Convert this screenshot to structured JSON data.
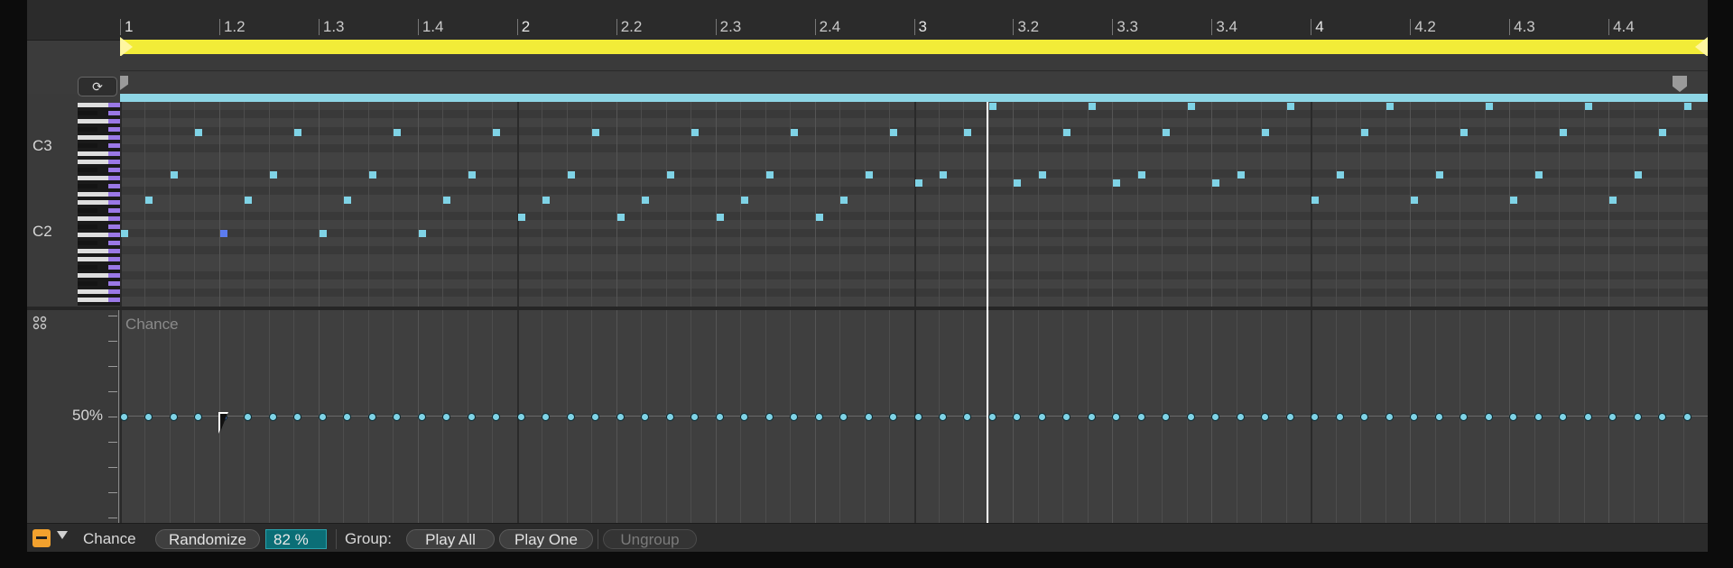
{
  "ruler": {
    "labels": [
      "1",
      "1.2",
      "1.3",
      "1.4",
      "2",
      "2.2",
      "2.3",
      "2.4",
      "3",
      "3.2",
      "3.3",
      "3.4",
      "4",
      "4.2",
      "4.3",
      "4.4"
    ]
  },
  "piano_roll": {
    "octave_labels": [
      "C3",
      "C2"
    ],
    "notes": [
      {
        "beat": 0.0,
        "pitch": 43
      },
      {
        "beat": 0.25,
        "pitch": 47
      },
      {
        "beat": 0.5,
        "pitch": 50
      },
      {
        "beat": 0.75,
        "pitch": 55
      },
      {
        "beat": 1.0,
        "pitch": 43,
        "selected": true
      },
      {
        "beat": 1.25,
        "pitch": 47
      },
      {
        "beat": 1.5,
        "pitch": 50
      },
      {
        "beat": 1.75,
        "pitch": 55
      },
      {
        "beat": 2.0,
        "pitch": 43
      },
      {
        "beat": 2.25,
        "pitch": 47
      },
      {
        "beat": 2.5,
        "pitch": 50
      },
      {
        "beat": 2.75,
        "pitch": 55
      },
      {
        "beat": 3.0,
        "pitch": 43
      },
      {
        "beat": 3.25,
        "pitch": 47
      },
      {
        "beat": 3.5,
        "pitch": 50
      },
      {
        "beat": 3.75,
        "pitch": 55
      },
      {
        "beat": 4.0,
        "pitch": 45
      },
      {
        "beat": 4.25,
        "pitch": 47
      },
      {
        "beat": 4.5,
        "pitch": 50
      },
      {
        "beat": 4.75,
        "pitch": 55
      },
      {
        "beat": 5.0,
        "pitch": 45
      },
      {
        "beat": 5.25,
        "pitch": 47
      },
      {
        "beat": 5.5,
        "pitch": 50
      },
      {
        "beat": 5.75,
        "pitch": 55
      },
      {
        "beat": 6.0,
        "pitch": 45
      },
      {
        "beat": 6.25,
        "pitch": 47
      },
      {
        "beat": 6.5,
        "pitch": 50
      },
      {
        "beat": 6.75,
        "pitch": 55
      },
      {
        "beat": 7.0,
        "pitch": 45
      },
      {
        "beat": 7.25,
        "pitch": 47
      },
      {
        "beat": 7.5,
        "pitch": 50
      },
      {
        "beat": 7.75,
        "pitch": 55
      },
      {
        "beat": 8.0,
        "pitch": 49
      },
      {
        "beat": 8.25,
        "pitch": 50
      },
      {
        "beat": 8.5,
        "pitch": 55
      },
      {
        "beat": 8.75,
        "pitch": 58
      },
      {
        "beat": 9.0,
        "pitch": 49
      },
      {
        "beat": 9.25,
        "pitch": 50
      },
      {
        "beat": 9.5,
        "pitch": 55
      },
      {
        "beat": 9.75,
        "pitch": 58
      },
      {
        "beat": 10.0,
        "pitch": 49
      },
      {
        "beat": 10.25,
        "pitch": 50
      },
      {
        "beat": 10.5,
        "pitch": 55
      },
      {
        "beat": 10.75,
        "pitch": 58
      },
      {
        "beat": 11.0,
        "pitch": 49
      },
      {
        "beat": 11.25,
        "pitch": 50
      },
      {
        "beat": 11.5,
        "pitch": 55
      },
      {
        "beat": 11.75,
        "pitch": 58
      },
      {
        "beat": 12.0,
        "pitch": 47
      },
      {
        "beat": 12.25,
        "pitch": 50
      },
      {
        "beat": 12.5,
        "pitch": 55
      },
      {
        "beat": 12.75,
        "pitch": 58
      },
      {
        "beat": 13.0,
        "pitch": 47
      },
      {
        "beat": 13.25,
        "pitch": 50
      },
      {
        "beat": 13.5,
        "pitch": 55
      },
      {
        "beat": 13.75,
        "pitch": 58
      },
      {
        "beat": 14.0,
        "pitch": 47
      },
      {
        "beat": 14.25,
        "pitch": 50
      },
      {
        "beat": 14.5,
        "pitch": 55
      },
      {
        "beat": 14.75,
        "pitch": 58
      },
      {
        "beat": 15.0,
        "pitch": 47
      },
      {
        "beat": 15.25,
        "pitch": 50
      },
      {
        "beat": 15.5,
        "pitch": 55
      },
      {
        "beat": 15.75,
        "pitch": 58
      }
    ]
  },
  "velocity_lane": {
    "title": "Chance",
    "value_label": "50%",
    "chance_value": 0.5,
    "dot_count": 64,
    "selected_index": 4
  },
  "bottom_bar": {
    "chance_label": "Chance",
    "randomize_label": "Randomize",
    "percent_value": "82 %",
    "group_label": "Group:",
    "play_all_label": "Play All",
    "play_one_label": "Play One",
    "ungroup_label": "Ungroup"
  },
  "colors": {
    "loop_bar": "#f2ec38",
    "note": "#7fd3e6",
    "note_selected": "#5c7cf0",
    "percent_box": "#0b6e76",
    "fold_accent": "#f2a12e"
  },
  "icons": {
    "fold": "loop-arrow-icon",
    "expand": "grid-dots-icon",
    "dropdown": "chevron-down-icon"
  }
}
